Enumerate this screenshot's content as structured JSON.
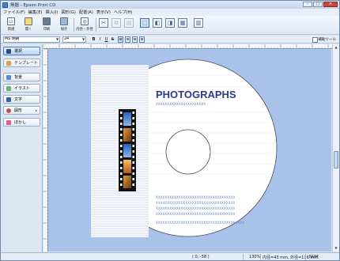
{
  "window": {
    "title": "無題 - Epson Print CD",
    "buttons": {
      "minimize": "–",
      "maximize": "□",
      "close": "✕"
    }
  },
  "menubar": {
    "items": [
      "ファイル(F)",
      "編集(E)",
      "挿入(I)",
      "図形(G)",
      "配置(A)",
      "表示(V)",
      "ヘルプ(H)"
    ]
  },
  "toolbar": {
    "buttons": [
      {
        "label": "新規",
        "icon": "new-document-icon"
      },
      {
        "label": "開く",
        "icon": "open-folder-icon"
      },
      {
        "label": "印刷",
        "icon": "printer-icon"
      },
      {
        "label": "保存",
        "icon": "save-disk-icon"
      },
      {
        "label": "内径・外径",
        "icon": "disc-diameter-icon"
      }
    ],
    "tool_icons": [
      "cut-icon",
      "copy-icon",
      "paste-icon",
      "select-all-icon",
      "bring-front-icon",
      "send-back-icon",
      "align-icon",
      "grid-icon"
    ]
  },
  "formatbar": {
    "font_name": "MS 明朝",
    "font_size": "24",
    "style_buttons": [
      "B",
      "I",
      "U",
      "S"
    ],
    "align_buttons": [
      "≡",
      "≡",
      "≡",
      "≡"
    ],
    "grid_tool_label": "補助ツール"
  },
  "sidebar": {
    "items": [
      {
        "label": "選択",
        "icon": "cursor-arrow-icon",
        "active": true,
        "arrow": ""
      },
      {
        "label": "テンプレート",
        "icon": "template-icon",
        "active": false,
        "arrow": ""
      },
      {
        "label": "背景",
        "icon": "background-icon",
        "active": false,
        "arrow": ""
      },
      {
        "label": "イラスト",
        "icon": "illustration-icon",
        "active": false,
        "arrow": ""
      },
      {
        "label": "文字",
        "icon": "text-icon",
        "active": false,
        "arrow": ""
      },
      {
        "label": "図形",
        "icon": "shape-icon",
        "active": false,
        "arrow": "▸"
      },
      {
        "label": "ぼかし",
        "icon": "blur-icon",
        "active": false,
        "arrow": ""
      }
    ]
  },
  "canvas": {
    "title_text": "PHOTOGRAPHS",
    "subtitle_placeholder": "XXXXXXXXXXXXXXXXXXXXXX",
    "body_placeholder_lines": [
      "XXXXXXXXXXXXXXXXXXXXXXXXXXXXXXXXXXX",
      "XXXXXXXXXXXXXXXXXXXXXXXXXXXXXXXXXXX",
      "XXXXXXXXXXXXXXXXXXXXXXXXXXXXXXXXXXX",
      "XXXXXXXXXXXXXXXXXXXXXXXXXXXXXXXXXXX",
      "XXXXXXXXXXXXXXXXXXXXXXXXXXXXXXXXXXXXXXX"
    ],
    "colors": {
      "background": "#a9c2ec",
      "disc": "#ffffff",
      "title": "#2d3a8c",
      "placeholder": "#6b82c9"
    }
  },
  "statusbar": {
    "coords": "( 0, -58 )",
    "zoom": "130%",
    "diameter": "内径=43 mm, 外径=116 mm",
    "num": "NUM"
  }
}
